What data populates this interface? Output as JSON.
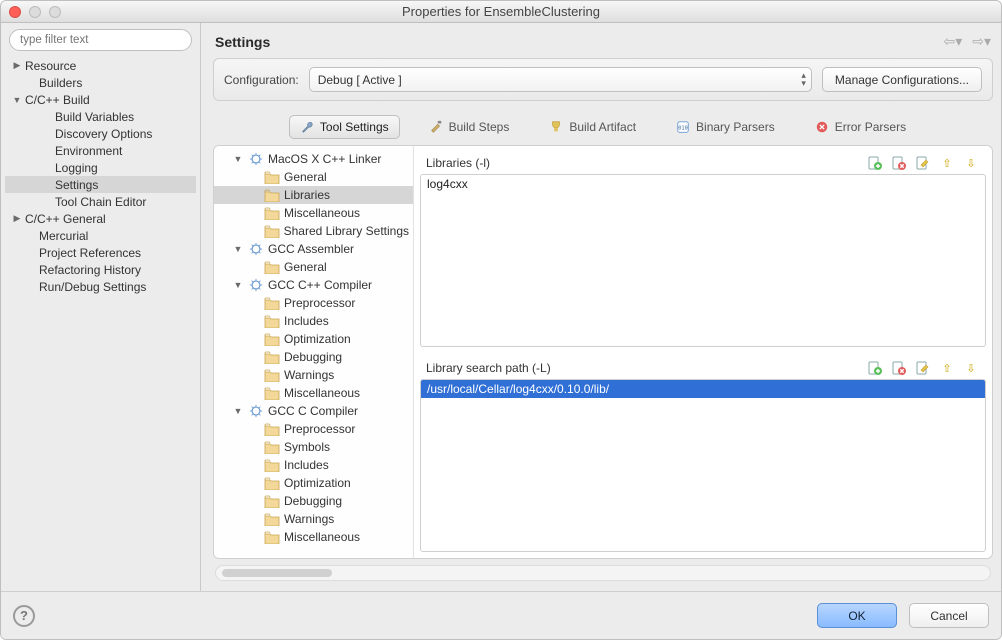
{
  "window": {
    "title": "Properties for EnsembleClustering"
  },
  "filter": {
    "placeholder": "type filter text"
  },
  "sidebar": {
    "items": [
      {
        "label": "Resource",
        "caret": "right",
        "depth": 0
      },
      {
        "label": "Builders",
        "caret": "none",
        "depth": 1
      },
      {
        "label": "C/C++ Build",
        "caret": "down",
        "depth": 0
      },
      {
        "label": "Build Variables",
        "caret": "none",
        "depth": 2
      },
      {
        "label": "Discovery Options",
        "caret": "none",
        "depth": 2
      },
      {
        "label": "Environment",
        "caret": "none",
        "depth": 2
      },
      {
        "label": "Logging",
        "caret": "none",
        "depth": 2
      },
      {
        "label": "Settings",
        "caret": "none",
        "depth": 2,
        "selected": true
      },
      {
        "label": "Tool Chain Editor",
        "caret": "none",
        "depth": 2
      },
      {
        "label": "C/C++ General",
        "caret": "right",
        "depth": 0
      },
      {
        "label": "Mercurial",
        "caret": "none",
        "depth": 1
      },
      {
        "label": "Project References",
        "caret": "none",
        "depth": 1
      },
      {
        "label": "Refactoring History",
        "caret": "none",
        "depth": 1
      },
      {
        "label": "Run/Debug Settings",
        "caret": "none",
        "depth": 1
      }
    ]
  },
  "main": {
    "title": "Settings",
    "config_label": "Configuration:",
    "config_value": "Debug  [ Active ]",
    "manage_btn": "Manage Configurations..."
  },
  "tabs": [
    {
      "label": "Tool Settings"
    },
    {
      "label": "Build Steps"
    },
    {
      "label": "Build Artifact"
    },
    {
      "label": "Binary Parsers"
    },
    {
      "label": "Error Parsers"
    }
  ],
  "tool_tree": [
    {
      "label": "MacOS X C++ Linker",
      "type": "tool",
      "caret": "down",
      "depth": 0
    },
    {
      "label": "General",
      "type": "folder",
      "depth": 1
    },
    {
      "label": "Libraries",
      "type": "folder",
      "depth": 1,
      "selected": true
    },
    {
      "label": "Miscellaneous",
      "type": "folder",
      "depth": 1
    },
    {
      "label": "Shared Library Settings",
      "type": "folder",
      "depth": 1
    },
    {
      "label": "GCC Assembler",
      "type": "tool",
      "caret": "down",
      "depth": 0
    },
    {
      "label": "General",
      "type": "folder",
      "depth": 1
    },
    {
      "label": "GCC C++ Compiler",
      "type": "tool",
      "caret": "down",
      "depth": 0
    },
    {
      "label": "Preprocessor",
      "type": "folder",
      "depth": 1
    },
    {
      "label": "Includes",
      "type": "folder",
      "depth": 1
    },
    {
      "label": "Optimization",
      "type": "folder",
      "depth": 1
    },
    {
      "label": "Debugging",
      "type": "folder",
      "depth": 1
    },
    {
      "label": "Warnings",
      "type": "folder",
      "depth": 1
    },
    {
      "label": "Miscellaneous",
      "type": "folder",
      "depth": 1
    },
    {
      "label": "GCC C Compiler",
      "type": "tool",
      "caret": "down",
      "depth": 0
    },
    {
      "label": "Preprocessor",
      "type": "folder",
      "depth": 1
    },
    {
      "label": "Symbols",
      "type": "folder",
      "depth": 1
    },
    {
      "label": "Includes",
      "type": "folder",
      "depth": 1
    },
    {
      "label": "Optimization",
      "type": "folder",
      "depth": 1
    },
    {
      "label": "Debugging",
      "type": "folder",
      "depth": 1
    },
    {
      "label": "Warnings",
      "type": "folder",
      "depth": 1
    },
    {
      "label": "Miscellaneous",
      "type": "folder",
      "depth": 1
    }
  ],
  "libs_panel": {
    "title": "Libraries (-l)",
    "items": [
      {
        "value": "log4cxx",
        "selected": false
      }
    ]
  },
  "paths_panel": {
    "title": "Library search path (-L)",
    "items": [
      {
        "value": "/usr/local/Cellar/log4cxx/0.10.0/lib/",
        "selected": true
      }
    ]
  },
  "footer": {
    "ok": "OK",
    "cancel": "Cancel"
  }
}
